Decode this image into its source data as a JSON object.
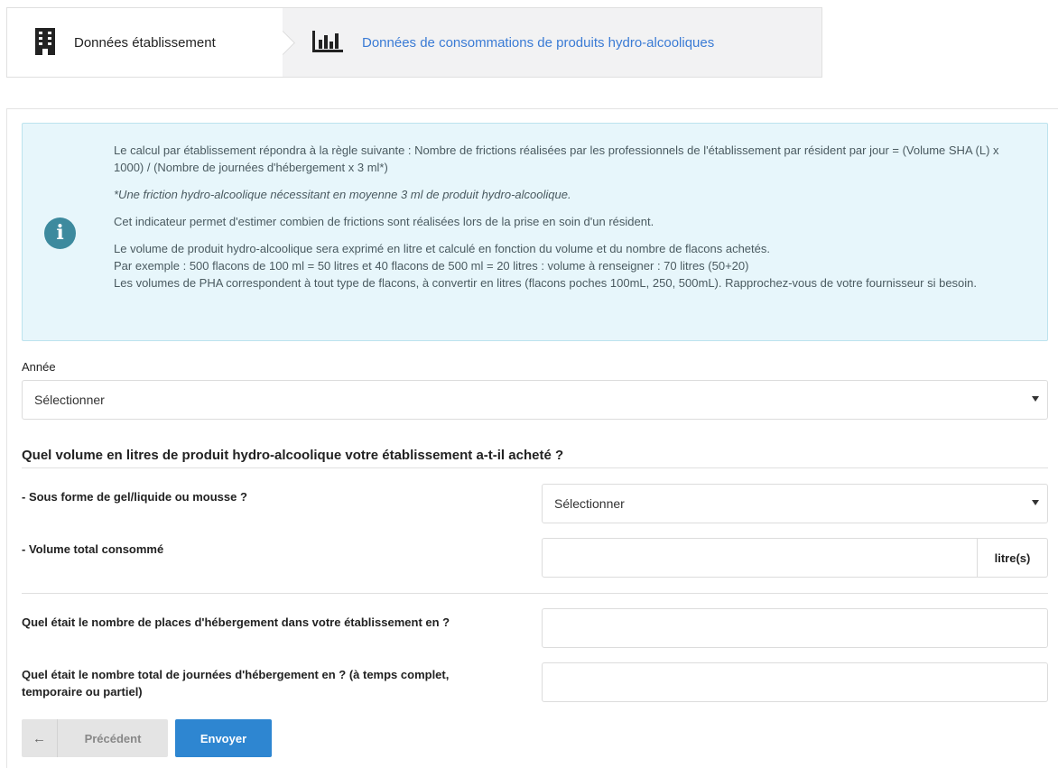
{
  "steps": {
    "step1": {
      "label": "Données établissement",
      "icon": "building-icon"
    },
    "step2": {
      "label": "Données de consommations de produits hydro-alcooliques",
      "icon": "bar-chart-icon"
    }
  },
  "info": {
    "icon": "info-icon",
    "p1": "Le calcul par établissement répondra à la règle suivante : Nombre de frictions réalisées par les professionnels de l'établissement par résident par jour = (Volume SHA (L) x 1000) / (Nombre de journées d'hébergement x 3 ml*)",
    "p2": "*Une friction hydro-alcoolique nécessitant en moyenne 3 ml de produit hydro-alcoolique.",
    "p3": "Cet indicateur permet d'estimer combien de frictions sont réalisées lors de la prise en soin d'un résident.",
    "p4_line1": "Le volume de produit hydro-alcoolique sera exprimé en litre et calculé en fonction du volume et du nombre de flacons achetés.",
    "p4_line2": "Par exemple : 500 flacons de 100 ml = 50 litres et 40 flacons de 500 ml = 20 litres : volume à renseigner : 70 litres (50+20)",
    "p4_line3": "Les volumes de PHA correspondent à tout type de flacons, à convertir en litres (flacons poches 100mL, 250, 500mL). Rapprochez-vous de votre fournisseur si besoin."
  },
  "form": {
    "annee_label": "Année",
    "annee_value": "Sélectionner",
    "section_title": "Quel volume en litres de produit hydro-alcoolique votre établissement a-t-il acheté ?",
    "forme_label": "- Sous forme de gel/liquide ou mousse ?",
    "forme_value": "Sélectionner",
    "volume_label": "- Volume total consommé",
    "volume_value": "",
    "volume_unit": "litre(s)",
    "places_label": "Quel était le nombre de places d'hébergement dans votre établissement en ?",
    "places_value": "",
    "journees_label_line1": "Quel était le nombre total de journées d'hébergement en ? (à temps complet,",
    "journees_label_line2": "temporaire ou partiel)",
    "journees_value": ""
  },
  "buttons": {
    "prev_label": "Précédent",
    "prev_icon": "arrow-left-icon",
    "send_label": "Envoyer"
  },
  "colors": {
    "accent": "#2e86d1",
    "step_active": "#3a7bd5",
    "info_bg": "#e7f6fb",
    "info_icon": "#3d8a9e"
  }
}
